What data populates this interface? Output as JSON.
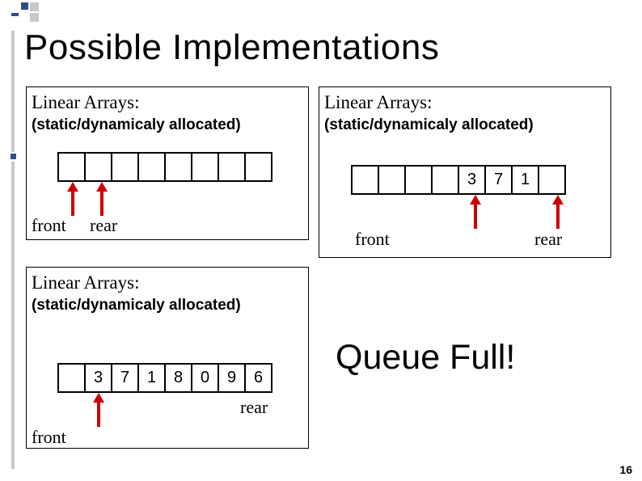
{
  "title": "Possible Implementations",
  "panel": {
    "heading": "Linear Arrays:",
    "sub": "(static/dynamicaly allocated)"
  },
  "labels": {
    "front": "front",
    "rear": "rear"
  },
  "p2cells": {
    "c0": "3",
    "c1": "7",
    "c2": "1"
  },
  "p3cells": {
    "c0": "3",
    "c1": "7",
    "c2": "1",
    "c3": "8",
    "c4": "0",
    "c5": "9",
    "c6": "6"
  },
  "queue_full": "Queue Full!",
  "slide_num": "16"
}
